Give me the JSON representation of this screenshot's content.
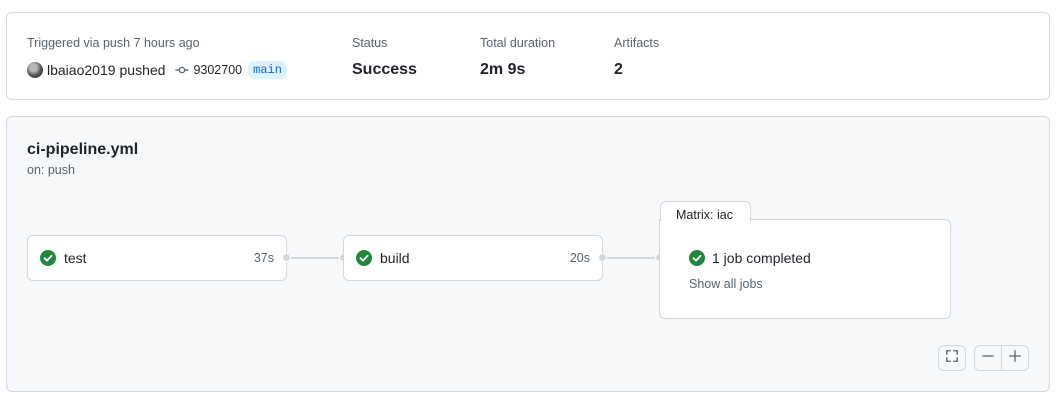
{
  "summary": {
    "trigger_label": "Triggered via push 7 hours ago",
    "actor": "lbaiao2019",
    "action": "pushed",
    "commit_sha": "9302700",
    "branch": "main",
    "status_label": "Status",
    "status_value": "Success",
    "duration_label": "Total duration",
    "duration_value": "2m 9s",
    "artifacts_label": "Artifacts",
    "artifacts_value": "2"
  },
  "workflow": {
    "file": "ci-pipeline.yml",
    "event": "on: push",
    "jobs": [
      {
        "name": "test",
        "duration": "37s",
        "status": "success"
      },
      {
        "name": "build",
        "duration": "20s",
        "status": "success"
      }
    ],
    "matrix": {
      "title": "Matrix: iac",
      "summary": "1 job completed",
      "link": "Show all jobs"
    }
  },
  "colors": {
    "success": "#1f883d",
    "branch_bg": "#ddf4ff",
    "branch_fg": "#0969da",
    "border": "#d0d7de"
  },
  "icons": {
    "success": "check-circle-icon",
    "commit": "git-commit-icon",
    "fullscreen": "fullscreen-icon",
    "zoom_out": "minus-icon",
    "zoom_in": "plus-icon"
  }
}
